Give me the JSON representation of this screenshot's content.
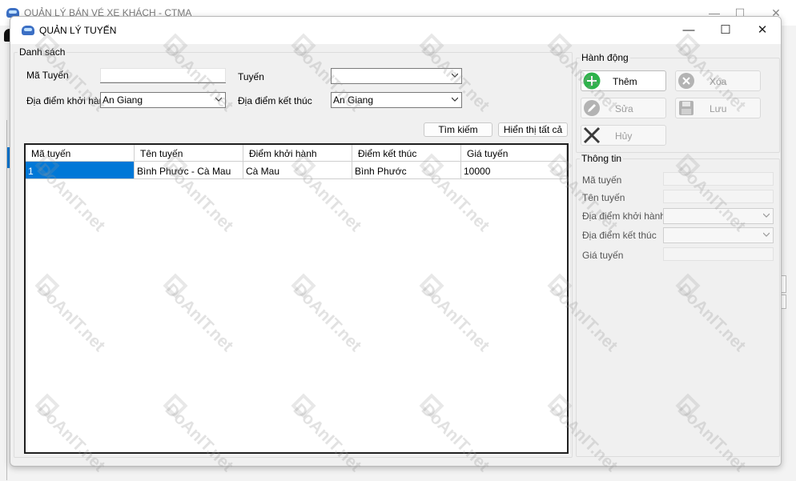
{
  "parent_window": {
    "title": "QUẢN LÝ BÁN VÉ XE KHÁCH - CTMA",
    "controls": [
      "—",
      "☐",
      "✕"
    ]
  },
  "child_window": {
    "title": "QUẢN LÝ TUYẾN",
    "controls": [
      "—",
      "☐",
      "✕"
    ]
  },
  "danh_sach": {
    "legend": "Danh sách",
    "ma_tuyen_label": "Mã Tuyến",
    "ma_tuyen_value": "",
    "tuyen_label": "Tuyến",
    "tuyen_value": "",
    "diem_khoi_hanh_label": "Địa điểm khởi hành",
    "diem_khoi_hanh_value": "An Giang",
    "diem_ket_thuc_label": "Địa điểm kết thúc",
    "diem_ket_thuc_value": "An Giang",
    "tim_kiem_label": "Tìm kiếm",
    "hien_thi_label": "Hiển thị tất cả"
  },
  "grid": {
    "columns": [
      "Mã tuyến",
      "Tên tuyến",
      "Điểm khởi hành",
      "Điểm kết thúc",
      "Giá tuyến"
    ],
    "rows": [
      [
        "1",
        "Bình Phước - Cà Mau",
        "Cà Mau",
        "Bình Phước",
        "10000"
      ]
    ]
  },
  "hanh_dong": {
    "legend": "Hành động",
    "them": "Thêm",
    "xoa": "Xóa",
    "sua": "Sửa",
    "luu": "Lưu",
    "huy": "Hủy"
  },
  "thong_tin": {
    "legend": "Thông tin",
    "ma_tuyen": "Mã tuyến",
    "ten_tuyen": "Tên tuyến",
    "dia_diem_khoi_hanh": "Địa điểm khởi hành",
    "dia_diem_ket_thuc": "Địa điểm kết thúc",
    "gia_tuyen": "Giá tuyến"
  },
  "watermark": "DoAnIT.net",
  "colors": {
    "accent": "#0078d7",
    "add_green": "#2db34a",
    "disabled_icon": "#a8a8a8"
  },
  "icons": {
    "them": "plus-circle-icon",
    "xoa": "x-circle-icon",
    "sua": "pencil-icon",
    "luu": "floppy-disk-icon",
    "huy": "cross-icon"
  }
}
